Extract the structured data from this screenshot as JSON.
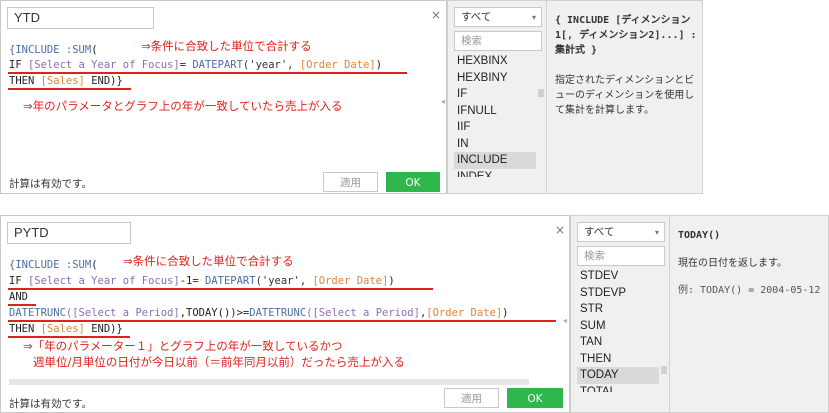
{
  "dialog1": {
    "name": "YTD",
    "close": "×",
    "code": {
      "l1_open": "{INCLUDE :",
      "l1_sum": "SUM",
      "l1_paren": "(",
      "l2_if": "IF ",
      "l2_param": "[Select a Year of Focus]",
      "l2_eq": "= ",
      "l2_fn": "DATEPART",
      "l2_args_open": "('year', ",
      "l2_field": "[Order Date]",
      "l2_close": ")",
      "l3_then": "THEN ",
      "l3_field": "[Sales]",
      "l3_end": " END)}"
    },
    "note1": "⇒条件に合致した単位で合計する",
    "note2": "⇒年のパラメータとグラフ上の年が一致していたら売上が入る",
    "status": "計算は有効です。",
    "apply": "適用",
    "ok": "OK",
    "category": "すべて",
    "search_placeholder": "検索",
    "functions": [
      "HEXBINX",
      "HEXBINY",
      "IF",
      "IFNULL",
      "IIF",
      "IN",
      "INCLUDE",
      "INDEX"
    ],
    "selected_function": "INCLUDE",
    "help_syntax": "{ INCLUDE [ディメンション1[, ディメンション2]...] : 集計式 }",
    "help_desc": "指定されたディメンションとビューのディメンションを使用して集計を計算します。"
  },
  "dialog2": {
    "name": "PYTD",
    "close": "×",
    "code": {
      "l1_open": "{INCLUDE :",
      "l1_sum": "SUM",
      "l1_paren": "(",
      "l2_if": "IF ",
      "l2_param": "[Select a Year of Focus]",
      "l2_eq": "-1= ",
      "l2_fn": "DATEPART",
      "l2_args_open": "('year', ",
      "l2_field": "[Order Date]",
      "l2_close": ")",
      "l3_and": "AND",
      "l4_fn1": "DATETRUNC",
      "l4_p1": "([Select a Period]",
      "l4_mid": ",TODAY())>=",
      "l4_fn2": "DATETRUNC",
      "l4_p2": "([Select a Period]",
      "l4_comma": ",",
      "l4_field": "[Order Date]",
      "l4_close": ")",
      "l5_then": "THEN ",
      "l5_field": "[Sales]",
      "l5_end": " END)}"
    },
    "note1": "⇒条件に合致した単位で合計する",
    "note2": "⇒「年のパラメーター１」とグラフ上の年が一致しているかつ",
    "note3": "週単位/月単位の日付が今日以前（＝前年同月以前）だったら売上が入る",
    "status": "計算は有効です。",
    "apply": "適用",
    "ok": "OK",
    "category": "すべて",
    "search_placeholder": "検索",
    "functions": [
      "STDEV",
      "STDEVP",
      "STR",
      "SUM",
      "TAN",
      "THEN",
      "TODAY",
      "TOTAL"
    ],
    "selected_function": "TODAY",
    "help_syntax": "TODAY()",
    "help_desc": "現在の日付を返します。",
    "help_example": "例: TODAY() = 2004-05-12"
  }
}
